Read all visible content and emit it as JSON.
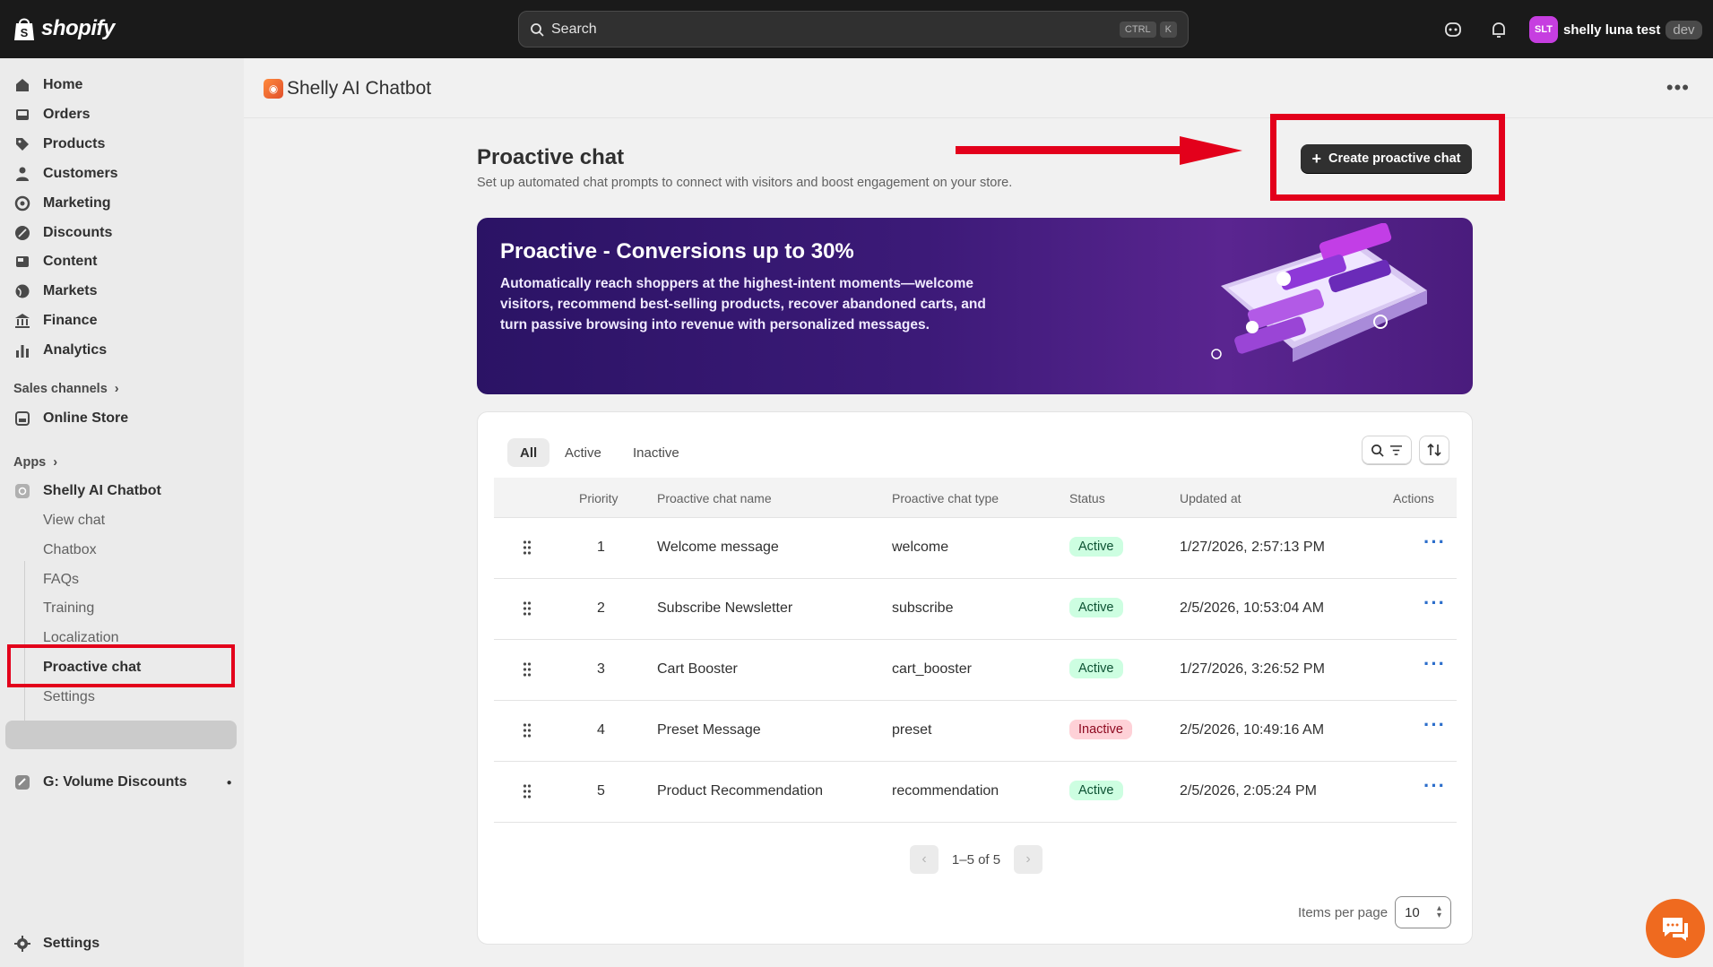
{
  "topbar": {
    "logo_text": "shopify",
    "search_label": "Search",
    "search_keys": [
      "CTRL",
      "K"
    ],
    "user_initials": "SLT",
    "user_name": "shelly luna test",
    "user_tag": "dev"
  },
  "sidebar": {
    "main_items": [
      {
        "label": "Home",
        "icon": "home-icon"
      },
      {
        "label": "Orders",
        "icon": "inbox-icon"
      },
      {
        "label": "Products",
        "icon": "tag-icon"
      },
      {
        "label": "Customers",
        "icon": "person-icon"
      },
      {
        "label": "Marketing",
        "icon": "target-icon"
      },
      {
        "label": "Discounts",
        "icon": "discount-icon"
      },
      {
        "label": "Content",
        "icon": "image-icon"
      },
      {
        "label": "Markets",
        "icon": "globe-icon"
      },
      {
        "label": "Finance",
        "icon": "bank-icon"
      },
      {
        "label": "Analytics",
        "icon": "bar-chart-icon"
      }
    ],
    "sales_channels_label": "Sales channels",
    "online_store": "Online Store",
    "apps_label": "Apps",
    "app_name": "Shelly AI Chatbot",
    "app_sub_items": [
      "View chat",
      "Chatbox",
      "FAQs",
      "Training",
      "Localization",
      "Proactive chat",
      "Settings"
    ],
    "active_sub_item": "Proactive chat",
    "other_app": "G: Volume Discounts",
    "settings": "Settings"
  },
  "header": {
    "app_title": "Shelly AI Chatbot"
  },
  "page": {
    "title": "Proactive chat",
    "subtitle": "Set up automated chat prompts to connect with visitors and boost engagement on your store.",
    "create_button": "Create proactive chat"
  },
  "banner": {
    "title": "Proactive - Conversions up to 30%",
    "text": "Automatically reach shoppers at the highest-intent moments—welcome visitors, recommend best-selling products, recover abandoned carts, and turn passive browsing into revenue with personalized messages."
  },
  "table": {
    "tabs": [
      "All",
      "Active",
      "Inactive"
    ],
    "active_tab": "All",
    "columns": [
      "Priority",
      "Proactive chat name",
      "Proactive chat type",
      "Status",
      "Updated at",
      "Actions"
    ],
    "rows": [
      {
        "priority": "1",
        "name": "Welcome message",
        "type": "welcome",
        "status": "Active",
        "updated": "1/27/2026, 2:57:13 PM"
      },
      {
        "priority": "2",
        "name": "Subscribe Newsletter",
        "type": "subscribe",
        "status": "Active",
        "updated": "2/5/2026, 10:53:04 AM"
      },
      {
        "priority": "3",
        "name": "Cart Booster",
        "type": "cart_booster",
        "status": "Active",
        "updated": "1/27/2026, 3:26:52 PM"
      },
      {
        "priority": "4",
        "name": "Preset Message",
        "type": "preset",
        "status": "Inactive",
        "updated": "2/5/2026, 10:49:16 AM"
      },
      {
        "priority": "5",
        "name": "Product Recommendation",
        "type": "recommendation",
        "status": "Active",
        "updated": "2/5/2026, 2:05:24 PM"
      }
    ],
    "pagination": "1–5 of 5",
    "items_per_page_label": "Items per page",
    "items_per_page": "10"
  },
  "colors": {
    "accent_red": "#e3001b",
    "active_badge": "#cdfee1",
    "inactive_badge": "#fed1d7",
    "chat_button": "#ef6a1f"
  }
}
